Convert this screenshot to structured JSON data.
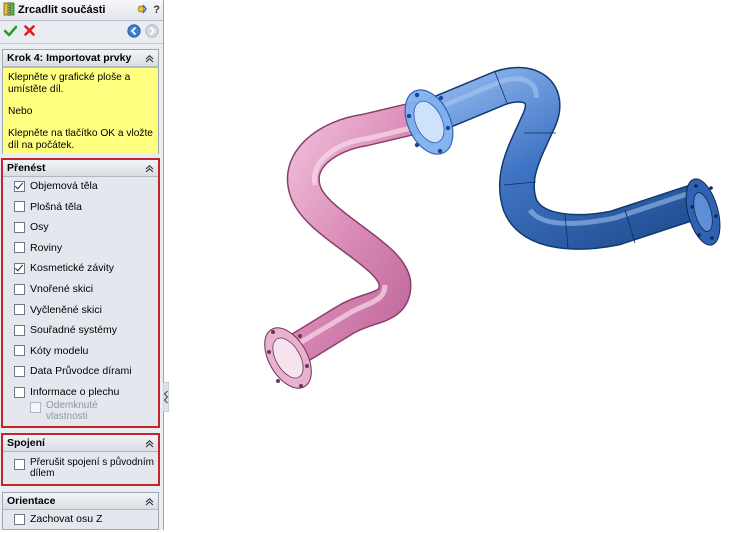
{
  "panel": {
    "title": "Zrcadlit součásti",
    "help_label": "?",
    "step": {
      "header": "Krok 4: Importovat prvky",
      "message_1": "Klepněte v grafické ploše a umístěte díl.",
      "message_2": "Nebo",
      "message_3": "Klepněte na tlačítko OK a vložte díl na počátek."
    },
    "transfer": {
      "header": "Přenést",
      "items": [
        {
          "label": "Objemová těla",
          "checked": true
        },
        {
          "label": "Plošná těla",
          "checked": false
        },
        {
          "label": "Osy",
          "checked": false
        },
        {
          "label": "Roviny",
          "checked": false
        },
        {
          "label": "Kosmetické závity",
          "checked": true
        },
        {
          "label": "Vnořené skici",
          "checked": false
        },
        {
          "label": "Vyčleněné skici",
          "checked": false
        },
        {
          "label": "Souřadné systémy",
          "checked": false
        },
        {
          "label": "Kóty modelu",
          "checked": false
        },
        {
          "label": "Data Průvodce dírami",
          "checked": false
        },
        {
          "label": "Informace o plechu",
          "checked": false
        }
      ],
      "unlocked_line1": "Odemknuté",
      "unlocked_line2": "vlastnosti"
    },
    "link": {
      "header": "Spojení",
      "break_line1": "Přerušit spojení s původním",
      "break_line2": "dílem"
    },
    "orientation": {
      "header": "Orientace",
      "keep_z": "Zachovat osu Z"
    }
  },
  "colors": {
    "mirrored_part": "#d98ab6",
    "original_part": "#3f74c4",
    "highlight": "#ffff80",
    "selection_border": "#c0262b"
  },
  "icons": [
    "mirror-part-icon",
    "help-icon",
    "ok-icon",
    "cancel-icon",
    "back-icon",
    "next-icon",
    "collapse-icon",
    "splitter-arrows-icon"
  ]
}
